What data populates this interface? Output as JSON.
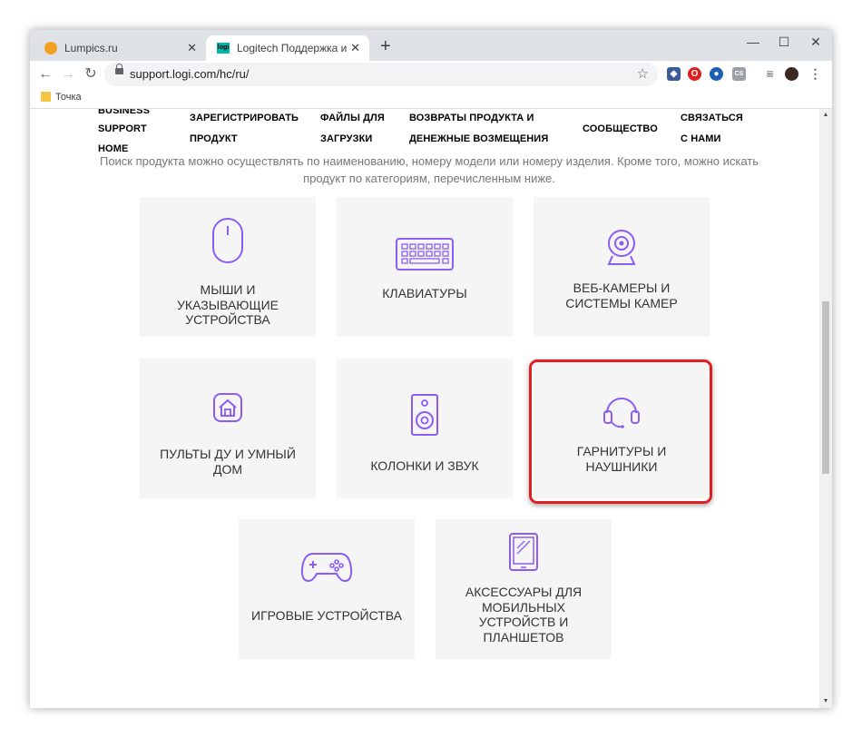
{
  "browser": {
    "tabs": [
      {
        "title": "Lumpics.ru",
        "active": false
      },
      {
        "title": "Logitech Поддержка и файлы д",
        "active": true
      }
    ],
    "new_tab": "+",
    "url": "support.logi.com/hc/ru/",
    "bookmark": "Точка",
    "controls": {
      "minimize": "—",
      "maximize": "☐",
      "close": "✕"
    }
  },
  "nav": {
    "business": "BUSINESS",
    "support": "SUPPORT",
    "home": "HOME",
    "register_1": "ЗАРЕГИСТРИРОВАТЬ",
    "register_2": "ПРОДУКТ",
    "downloads_1": "ФАЙЛЫ ДЛЯ",
    "downloads_2": "ЗАГРУЗКИ",
    "returns_1": "ВОЗВРАТЫ ПРОДУКТА И",
    "returns_2": "ДЕНЕЖНЫЕ ВОЗМЕЩЕНИЯ",
    "community": "СООБЩЕСТВО",
    "contact_1": "СВЯЗАТЬСЯ",
    "contact_2": "С НАМИ"
  },
  "intro": "Поиск продукта можно осуществлять по наименованию, номеру модели или номеру изделия. Кроме того, можно искать продукт по категориям, перечисленным ниже.",
  "categories": [
    {
      "label": "Мыши и указывающие устройства",
      "icon": "mouse-icon"
    },
    {
      "label": "Клавиатуры",
      "icon": "keyboard-icon"
    },
    {
      "label": "Веб-камеры и системы камер",
      "icon": "webcam-icon"
    },
    {
      "label": "Пульты ДУ и умный дом",
      "icon": "home-icon"
    },
    {
      "label": "Колонки и звук",
      "icon": "speaker-icon"
    },
    {
      "label": "Гарнитуры и наушники",
      "icon": "headset-icon"
    },
    {
      "label": "Игровые устройства",
      "icon": "gamepad-icon"
    },
    {
      "label": "Аксессуары для мобильных устройств и планшетов",
      "icon": "tablet-icon"
    }
  ],
  "colors": {
    "icon": "#8b5cf6",
    "highlight": "#e02020",
    "card_bg": "#f5f5f5"
  }
}
